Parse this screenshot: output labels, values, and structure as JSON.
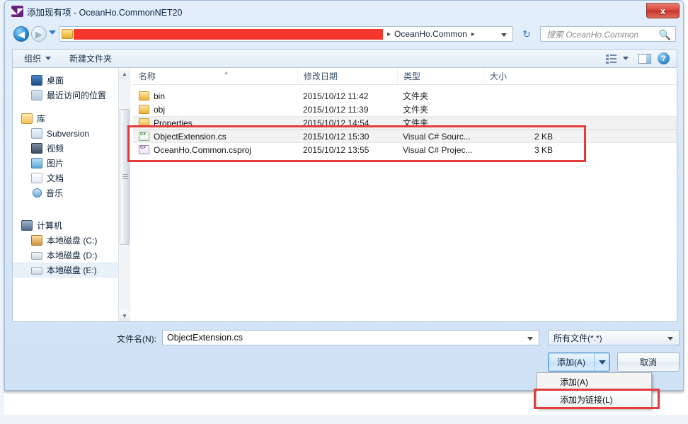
{
  "window": {
    "title": "添加现有项 - OceanHo.CommonNET20",
    "icon": "visual-studio-icon",
    "close_label": "x"
  },
  "nav": {
    "back_glyph": "◀",
    "forward_glyph": "▶",
    "address": {
      "redacted": true,
      "separator": "▸",
      "crumb": "OceanHo.Common",
      "trailing_separator": "▸"
    },
    "refresh_glyph": "↻",
    "search": {
      "placeholder": "搜索 OceanHo.Common",
      "icon": "search-icon"
    }
  },
  "commandbar": {
    "organize": "组织",
    "new_folder": "新建文件夹",
    "view_icon": "view-list-icon",
    "preview_pane_icon": "preview-pane-icon",
    "help_icon": "help-icon"
  },
  "navpane": {
    "items": [
      {
        "label": "桌面",
        "icon": "desktop-icon",
        "level": "child",
        "selected": false
      },
      {
        "label": "最近访问的位置",
        "icon": "recent-places-icon",
        "level": "child",
        "selected": false
      },
      {
        "label": "库",
        "icon": "library-icon",
        "level": "root",
        "selected": false
      },
      {
        "label": "Subversion",
        "icon": "subversion-icon",
        "level": "child",
        "selected": false
      },
      {
        "label": "视频",
        "icon": "videos-icon",
        "level": "child",
        "selected": false
      },
      {
        "label": "图片",
        "icon": "pictures-icon",
        "level": "child",
        "selected": false
      },
      {
        "label": "文档",
        "icon": "documents-icon",
        "level": "child",
        "selected": false
      },
      {
        "label": "音乐",
        "icon": "music-icon",
        "level": "child",
        "selected": false
      },
      {
        "label": "计算机",
        "icon": "computer-icon",
        "level": "root",
        "selected": false
      },
      {
        "label": "本地磁盘 (C:)",
        "icon": "disk-c-icon",
        "level": "child",
        "selected": false
      },
      {
        "label": "本地磁盘 (D:)",
        "icon": "disk-icon",
        "level": "child",
        "selected": false
      },
      {
        "label": "本地磁盘 (E:)",
        "icon": "disk-icon",
        "level": "child",
        "selected": true
      }
    ]
  },
  "filelist": {
    "columns": [
      "名称",
      "修改日期",
      "类型",
      "大小"
    ],
    "rows": [
      {
        "name": "bin",
        "date": "2015/10/12 11:42",
        "type": "文件夹",
        "size": "",
        "icon": "folder-icon",
        "selected": false
      },
      {
        "name": "obj",
        "date": "2015/10/12 11:39",
        "type": "文件夹",
        "size": "",
        "icon": "folder-icon",
        "selected": false
      },
      {
        "name": "Properties",
        "date": "2015/10/12 14:54",
        "type": "文件夹",
        "size": "",
        "icon": "folder-icon",
        "selected": true
      },
      {
        "name": "ObjectExtension.cs",
        "date": "2015/10/12 15:30",
        "type": "Visual C# Sourc...",
        "size": "2 KB",
        "icon": "csharp-source-icon",
        "selected": true
      },
      {
        "name": "OceanHo.Common.csproj",
        "date": "2015/10/12 13:55",
        "type": "Visual C# Projec...",
        "size": "3 KB",
        "icon": "csharp-project-icon",
        "selected": false
      }
    ]
  },
  "footer": {
    "filename_label": "文件名(N):",
    "filename_value": "ObjectExtension.cs",
    "filter_value": "所有文件(*.*)",
    "add_button": "添加(A)",
    "cancel_button": "取消"
  },
  "dropdown": {
    "items": [
      {
        "label": "添加(A)",
        "highlighted": false
      },
      {
        "label": "添加为链接(L)",
        "highlighted": true
      }
    ]
  },
  "annotations": {
    "red_color": "#e23b3b",
    "redaction_color": "#f5352e"
  }
}
